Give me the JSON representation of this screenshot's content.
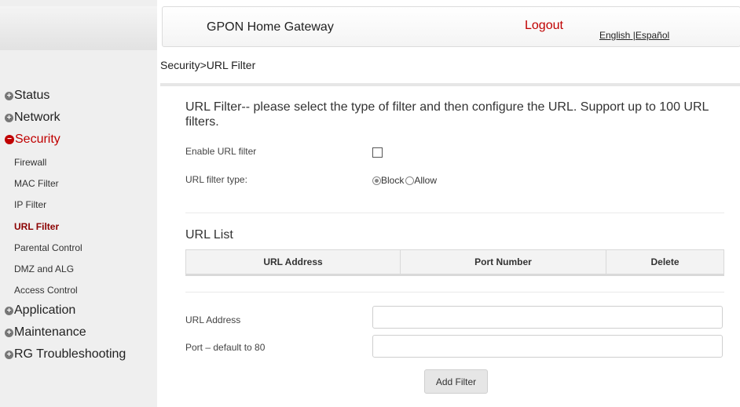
{
  "header": {
    "brand": "GPON Home Gateway",
    "logout": "Logout",
    "lang_english": "English",
    "lang_sep": " |",
    "lang_spanish": "Español"
  },
  "sidebar": {
    "top": [
      {
        "label": "Status",
        "icon": "plus-icon"
      },
      {
        "label": "Network",
        "icon": "plus-icon"
      },
      {
        "label": "Security",
        "icon": "minus-icon",
        "active": true
      },
      {
        "label": "Application",
        "icon": "plus-icon"
      },
      {
        "label": "Maintenance",
        "icon": "plus-icon"
      },
      {
        "label": "RG Troubleshooting",
        "icon": "plus-icon"
      }
    ],
    "security_sub": [
      "Firewall",
      "MAC Filter",
      "IP Filter",
      "URL Filter",
      "Parental Control",
      "DMZ and ALG",
      "Access Control"
    ],
    "active_sub": "URL Filter"
  },
  "breadcrumb": "Security>URL Filter",
  "page": {
    "title": "URL Filter-- please select the type of filter and then configure the URL. Support up to 100 URL filters.",
    "enable_label": "Enable URL filter",
    "enable_checked": false,
    "type_label": "URL filter type:",
    "type_options": [
      "Block",
      "Allow"
    ],
    "type_selected": "Block",
    "list_title": "URL List",
    "table_headers": [
      "URL Address",
      "Port Number",
      "Delete"
    ],
    "url_label": "URL Address",
    "url_value": "",
    "port_label": "Port – default to 80",
    "port_value": "",
    "add_button": "Add Filter"
  },
  "colors": {
    "accent": "#c00000",
    "sidebar_bg": "#efefef",
    "active_sub": "#8b0000"
  }
}
